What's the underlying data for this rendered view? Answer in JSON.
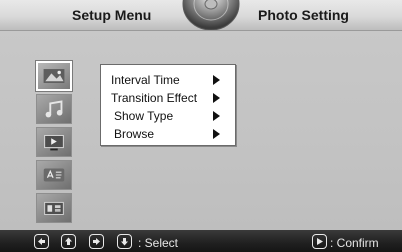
{
  "header": {
    "left_tab": "Setup Menu",
    "right_tab": "Photo Setting"
  },
  "sidebar": {
    "icons": [
      {
        "name": "photo-settings-icon",
        "selected": true
      },
      {
        "name": "music-settings-icon",
        "selected": false
      },
      {
        "name": "video-settings-icon",
        "selected": false
      },
      {
        "name": "text-settings-icon",
        "selected": false
      },
      {
        "name": "system-settings-icon",
        "selected": false
      }
    ]
  },
  "menu": {
    "items": [
      {
        "label": "Interval Time"
      },
      {
        "label": "Transition Effect"
      },
      {
        "label": "Show Type"
      },
      {
        "label": "Browse"
      }
    ]
  },
  "footer": {
    "keys": [
      "left-key-icon",
      "up-key-icon",
      "right-key-icon",
      "down-key-icon"
    ],
    "select_label": ": Select",
    "confirm_key": "play-key-icon",
    "confirm_label": ": Confirm"
  },
  "colors": {
    "background": "#c3c3c3",
    "footer": "#202020",
    "menu_box": "#ffffff"
  }
}
